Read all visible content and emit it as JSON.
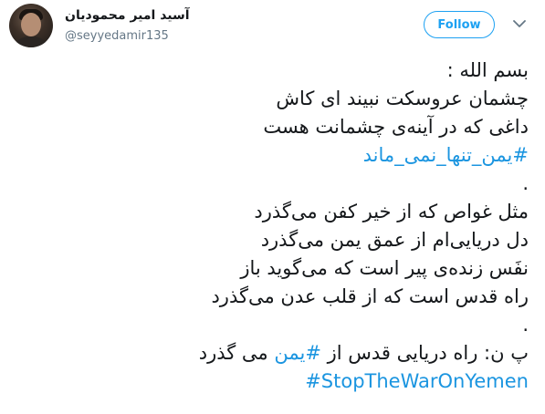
{
  "tweet": {
    "author": {
      "display_name": "آسید امیر محمودیان",
      "handle": "@seyyedamir135"
    },
    "follow_label": "Follow",
    "lines": [
      "بسم الله :",
      "چشمان عروسکت نبیند ای کاش",
      "داغی که در آینه‌ی چشمانت هست",
      "#یمن_تنها_نمی_ماند",
      ".",
      "مثل غواص که از خیر کفن می‌گذرد",
      "دل دریایی‌ام از عمق یمن می‌گذرد",
      "نفَس زنده‌ی پیر است که می‌گوید باز",
      "راه قدس است که از قلب عدن می‌گذرد",
      ".",
      "پ ن: راه دریایی قدس از ",
      "#یمن",
      " می گذرد",
      "#StopTheWarOnYemen"
    ]
  },
  "colors": {
    "link": "#1b95e0",
    "accent": "#1da1f2",
    "text": "#14171a",
    "muted": "#657786"
  },
  "icons": {
    "avatar": "profile-photo",
    "menu": "chevron-down-icon"
  }
}
